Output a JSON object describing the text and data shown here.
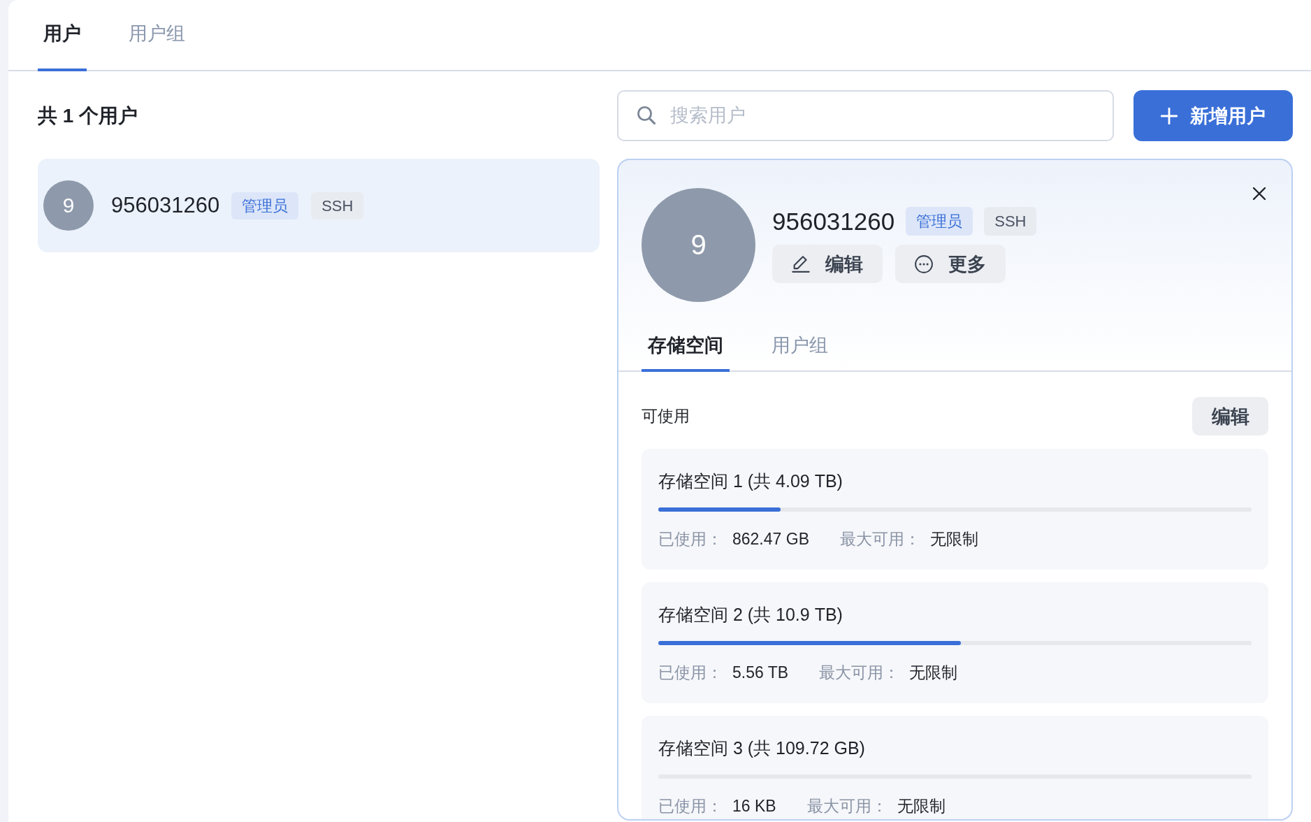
{
  "tabs": [
    {
      "label": "用户",
      "selected": true
    },
    {
      "label": "用户组",
      "selected": false
    }
  ],
  "user_count": "共 1 个用户",
  "search": {
    "placeholder": "搜索用户"
  },
  "add_button": {
    "label": "新增用户"
  },
  "user_list": [
    {
      "avatar": "9",
      "name": "956031260",
      "selected": true,
      "tags": [
        {
          "label": "管理员",
          "kind": "role"
        },
        {
          "label": "SSH",
          "kind": "access"
        }
      ]
    }
  ],
  "detail": {
    "avatar": "9",
    "name": "956031260",
    "tags": [
      {
        "label": "管理员",
        "kind": "role"
      },
      {
        "label": "SSH",
        "kind": "access"
      }
    ],
    "actions": [
      {
        "label": "编辑",
        "kind": "edit"
      },
      {
        "label": "更多",
        "kind": "more"
      }
    ],
    "tabs": [
      {
        "label": "存储空间",
        "selected": true
      },
      {
        "label": "用户组",
        "selected": false
      }
    ],
    "section_title": "可使用",
    "section_button": "编辑",
    "storage": [
      {
        "title": "存储空间 1 (共 4.09 TB)",
        "level": 0.206,
        "used_label": "已使用：",
        "used": "862.47 GB",
        "max_label": "最大可用：",
        "max": "无限制"
      },
      {
        "title": "存储空间 2 (共 10.9 TB)",
        "level": 0.51,
        "used_label": "已使用：",
        "used": "5.56 TB",
        "max_label": "最大可用：",
        "max": "无限制"
      },
      {
        "title": "存储空间 3 (共 109.72 GB)",
        "used_label": "已使用：",
        "used": "16 KB",
        "max_label": "最大可用：",
        "max": "无限制"
      }
    ]
  }
}
